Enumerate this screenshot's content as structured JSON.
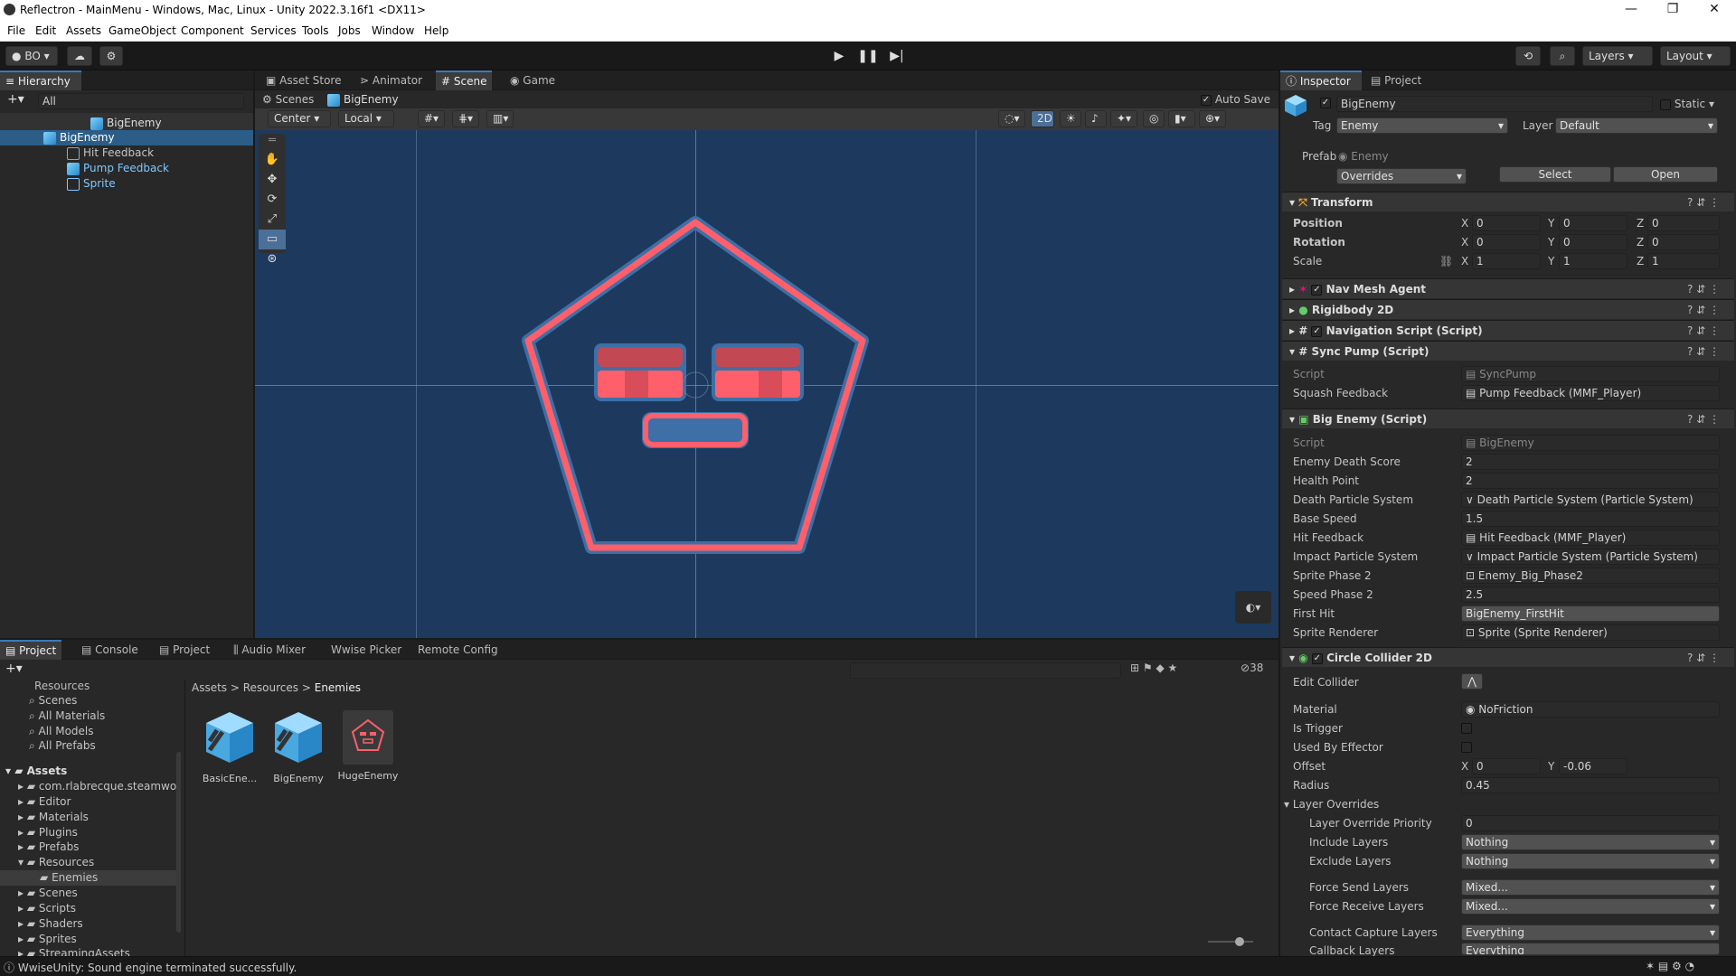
{
  "window": {
    "title": "Reflectron - MainMenu - Windows, Mac, Linux - Unity 2022.3.16f1 <DX11>",
    "minimize": "—",
    "maximize": "❐",
    "close": "✕"
  },
  "menu": [
    "File",
    "Edit",
    "Assets",
    "GameObject",
    "Component",
    "Services",
    "Tools",
    "Jobs",
    "Window",
    "Help"
  ],
  "toolbar": {
    "account": "BO",
    "layers": "Layers",
    "layout": "Layout"
  },
  "hierarchy": {
    "tab": "Hierarchy",
    "search_placeholder": "All",
    "root": "BigEnemy",
    "items": [
      "BigEnemy",
      "Hit Feedback",
      "Pump Feedback",
      "Sprite"
    ]
  },
  "scene_tabs": [
    "Asset Store",
    "Animator",
    "Scene",
    "Game"
  ],
  "scene": {
    "breadcrumb_scenes": "Scenes",
    "breadcrumb_object": "BigEnemy",
    "auto_save": "Auto Save",
    "pivot": "Center",
    "space": "Local",
    "mode_2d": "2D"
  },
  "colors": {
    "scene_bg": "#1d3a5e",
    "enemy_red": "#ff5f6b",
    "panel": "#282828",
    "accent": "#3a79bb"
  },
  "bottom_tabs": [
    "Project",
    "Console",
    "Project",
    "Audio Mixer",
    "Wwise Picker",
    "Remote Config"
  ],
  "project": {
    "favorites": [
      "Resources",
      "Scenes",
      "All Materials",
      "All Models",
      "All Prefabs"
    ],
    "assets_root": "Assets",
    "folders": [
      "com.rlabrecque.steamwor",
      "Editor",
      "Materials",
      "Plugins",
      "Prefabs",
      "Resources",
      "Enemies",
      "Scenes",
      "Scripts",
      "Shaders",
      "Sprites",
      "StreamingAssets"
    ],
    "breadcrumb": [
      "Assets",
      "Resources",
      "Enemies"
    ],
    "items": [
      "BasicEne...",
      "BigEnemy",
      "HugeEnemy"
    ],
    "count": "38"
  },
  "status": {
    "message": "WwiseUnity: Sound engine terminated successfully."
  },
  "inspector": {
    "tabs": [
      "Inspector",
      "Project"
    ],
    "object_name": "BigEnemy",
    "static": "Static",
    "tag_label": "Tag",
    "tag": "Enemy",
    "layer_label": "Layer",
    "layer": "Default",
    "prefab_label": "Prefab",
    "prefab": "Enemy",
    "overrides": "Overrides",
    "select": "Select",
    "open": "Open",
    "transform": {
      "title": "Transform",
      "position": "Position",
      "rotation": "Rotation",
      "scale": "Scale",
      "pos": [
        "0",
        "0",
        "0"
      ],
      "rot": [
        "0",
        "0",
        "0"
      ],
      "scl": [
        "1",
        "1",
        "1"
      ]
    },
    "components": [
      "Nav Mesh Agent",
      "Rigidbody 2D",
      "Navigation Script (Script)",
      "Sync Pump (Script)"
    ],
    "sync": {
      "script_label": "Script",
      "script": "SyncPump",
      "squash_label": "Squash Feedback",
      "squash": "Pump Feedback (MMF_Player)"
    },
    "big": {
      "title": "Big Enemy (Script)",
      "rows": [
        [
          "Script",
          "BigEnemy"
        ],
        [
          "Enemy Death Score",
          "2"
        ],
        [
          "Health Point",
          "2"
        ],
        [
          "Death Particle System",
          "Death Particle System (Particle System)"
        ],
        [
          "Base Speed",
          "1.5"
        ],
        [
          "Hit Feedback",
          "Hit Feedback (MMF_Player)"
        ],
        [
          "Impact Particle System",
          "Impact Particle System (Particle System)"
        ],
        [
          "Sprite Phase 2",
          "Enemy_Big_Phase2"
        ],
        [
          "Speed Phase 2",
          "2.5"
        ],
        [
          "First Hit",
          "BigEnemy_FirstHit"
        ],
        [
          "Sprite Renderer",
          "Sprite (Sprite Renderer)"
        ]
      ]
    },
    "collider": {
      "title": "Circle Collider 2D",
      "edit": "Edit Collider",
      "material_label": "Material",
      "material": "NoFriction",
      "trigger": "Is Trigger",
      "effector": "Used By Effector",
      "offset_label": "Offset",
      "offset_x": "0",
      "offset_y": "-0.06",
      "radius_label": "Radius",
      "radius": "0.45",
      "overrides": "Layer Overrides",
      "rows": [
        [
          "Layer Override Priority",
          "0"
        ],
        [
          "Include Layers",
          "Nothing"
        ],
        [
          "Exclude Layers",
          "Nothing"
        ],
        [
          "Force Send Layers",
          "Mixed..."
        ],
        [
          "Force Receive Layers",
          "Mixed..."
        ],
        [
          "Contact Capture Layers",
          "Everything"
        ],
        [
          "Callback Layers",
          "Everything"
        ]
      ]
    }
  }
}
